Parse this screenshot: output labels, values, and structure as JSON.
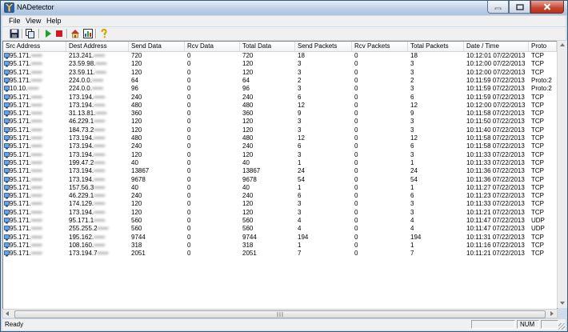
{
  "window": {
    "title": "NADetector"
  },
  "menu": [
    "File",
    "View",
    "Help"
  ],
  "toolbar": [
    "save-icon",
    "copy-icon",
    "start-icon",
    "stop-icon",
    "home-icon",
    "options-icon",
    "help-icon"
  ],
  "columns": [
    "Src Address",
    "Dest Address",
    "Send Data",
    "Rcv Data",
    "Total Data",
    "Send Packets",
    "Rcv Packets",
    "Total Packets",
    "Date / Time",
    "Proto"
  ],
  "rows": [
    [
      "95.171.",
      "213.241.",
      "720",
      "0",
      "720",
      "18",
      "0",
      "18",
      "10:12:01 07/22/2013",
      "TCP"
    ],
    [
      "95.171.",
      "23.59.98.",
      "120",
      "0",
      "120",
      "3",
      "0",
      "3",
      "10:12:00 07/22/2013",
      "TCP"
    ],
    [
      "95.171.",
      "23.59.11.",
      "120",
      "0",
      "120",
      "3",
      "0",
      "3",
      "10:12:00 07/22/2013",
      "TCP"
    ],
    [
      "95.171.",
      "224.0.0.",
      "64",
      "0",
      "64",
      "2",
      "0",
      "2",
      "10:11:59 07/22/2013",
      "Proto:2"
    ],
    [
      "10.10.",
      "224.0.0.",
      "96",
      "0",
      "96",
      "3",
      "0",
      "3",
      "10:11:59 07/22/2013",
      "Proto:2"
    ],
    [
      "95.171.",
      "173.194.",
      "240",
      "0",
      "240",
      "6",
      "0",
      "6",
      "10:11:59 07/22/2013",
      "TCP"
    ],
    [
      "95.171.",
      "173.194.",
      "480",
      "0",
      "480",
      "12",
      "0",
      "12",
      "10:12:00 07/22/2013",
      "TCP"
    ],
    [
      "95.171.",
      "31.13.81.",
      "360",
      "0",
      "360",
      "9",
      "0",
      "9",
      "10:11:58 07/22/2013",
      "TCP"
    ],
    [
      "95.171.",
      "46.229.1",
      "120",
      "0",
      "120",
      "3",
      "0",
      "3",
      "10:11:50 07/22/2013",
      "TCP"
    ],
    [
      "95.171.",
      "184.73.2",
      "120",
      "0",
      "120",
      "3",
      "0",
      "3",
      "10:11:40 07/22/2013",
      "TCP"
    ],
    [
      "95.171.",
      "173.194.",
      "480",
      "0",
      "480",
      "12",
      "0",
      "12",
      "10:11:58 07/22/2013",
      "TCP"
    ],
    [
      "95.171.",
      "173.194.",
      "240",
      "0",
      "240",
      "6",
      "0",
      "6",
      "10:11:58 07/22/2013",
      "TCP"
    ],
    [
      "95.171.",
      "173.194.",
      "120",
      "0",
      "120",
      "3",
      "0",
      "3",
      "10:11:33 07/22/2013",
      "TCP"
    ],
    [
      "95.171.",
      "199.47.2",
      "40",
      "0",
      "40",
      "1",
      "0",
      "1",
      "10:11:33 07/22/2013",
      "TCP"
    ],
    [
      "95.171.",
      "173.194.",
      "13867",
      "0",
      "13867",
      "24",
      "0",
      "24",
      "10:11:36 07/22/2013",
      "TCP"
    ],
    [
      "95.171.",
      "173.194.",
      "9678",
      "0",
      "9678",
      "54",
      "0",
      "54",
      "10:11:36 07/22/2013",
      "TCP"
    ],
    [
      "95.171.",
      "157.56.3",
      "40",
      "0",
      "40",
      "1",
      "0",
      "1",
      "10:11:27 07/22/2013",
      "TCP"
    ],
    [
      "95.171.",
      "46.229.1",
      "240",
      "0",
      "240",
      "6",
      "0",
      "6",
      "10:11:23 07/22/2013",
      "TCP"
    ],
    [
      "95.171.",
      "174.129.",
      "120",
      "0",
      "120",
      "3",
      "0",
      "3",
      "10:11:33 07/22/2013",
      "TCP"
    ],
    [
      "95.171.",
      "173.194.",
      "120",
      "0",
      "120",
      "3",
      "0",
      "3",
      "10:11:21 07/22/2013",
      "TCP"
    ],
    [
      "95.171.",
      "95.171.1",
      "560",
      "0",
      "560",
      "4",
      "0",
      "4",
      "10:11:47 07/22/2013",
      "UDP"
    ],
    [
      "95.171.",
      "255.255.2",
      "560",
      "0",
      "560",
      "4",
      "0",
      "4",
      "10:11:47 07/22/2013",
      "UDP"
    ],
    [
      "95.171.",
      "195.162.",
      "9744",
      "0",
      "9744",
      "194",
      "0",
      "194",
      "10:11:31 07/22/2013",
      "TCP"
    ],
    [
      "95.171.",
      "108.160.",
      "318",
      "0",
      "318",
      "1",
      "0",
      "1",
      "10:11:16 07/22/2013",
      "TCP"
    ],
    [
      "95.171.",
      "173.194.7",
      "2051",
      "0",
      "2051",
      "7",
      "0",
      "7",
      "10:11:21 07/22/2013",
      "TCP"
    ]
  ],
  "status": {
    "text": "Ready",
    "num": "NUM"
  }
}
